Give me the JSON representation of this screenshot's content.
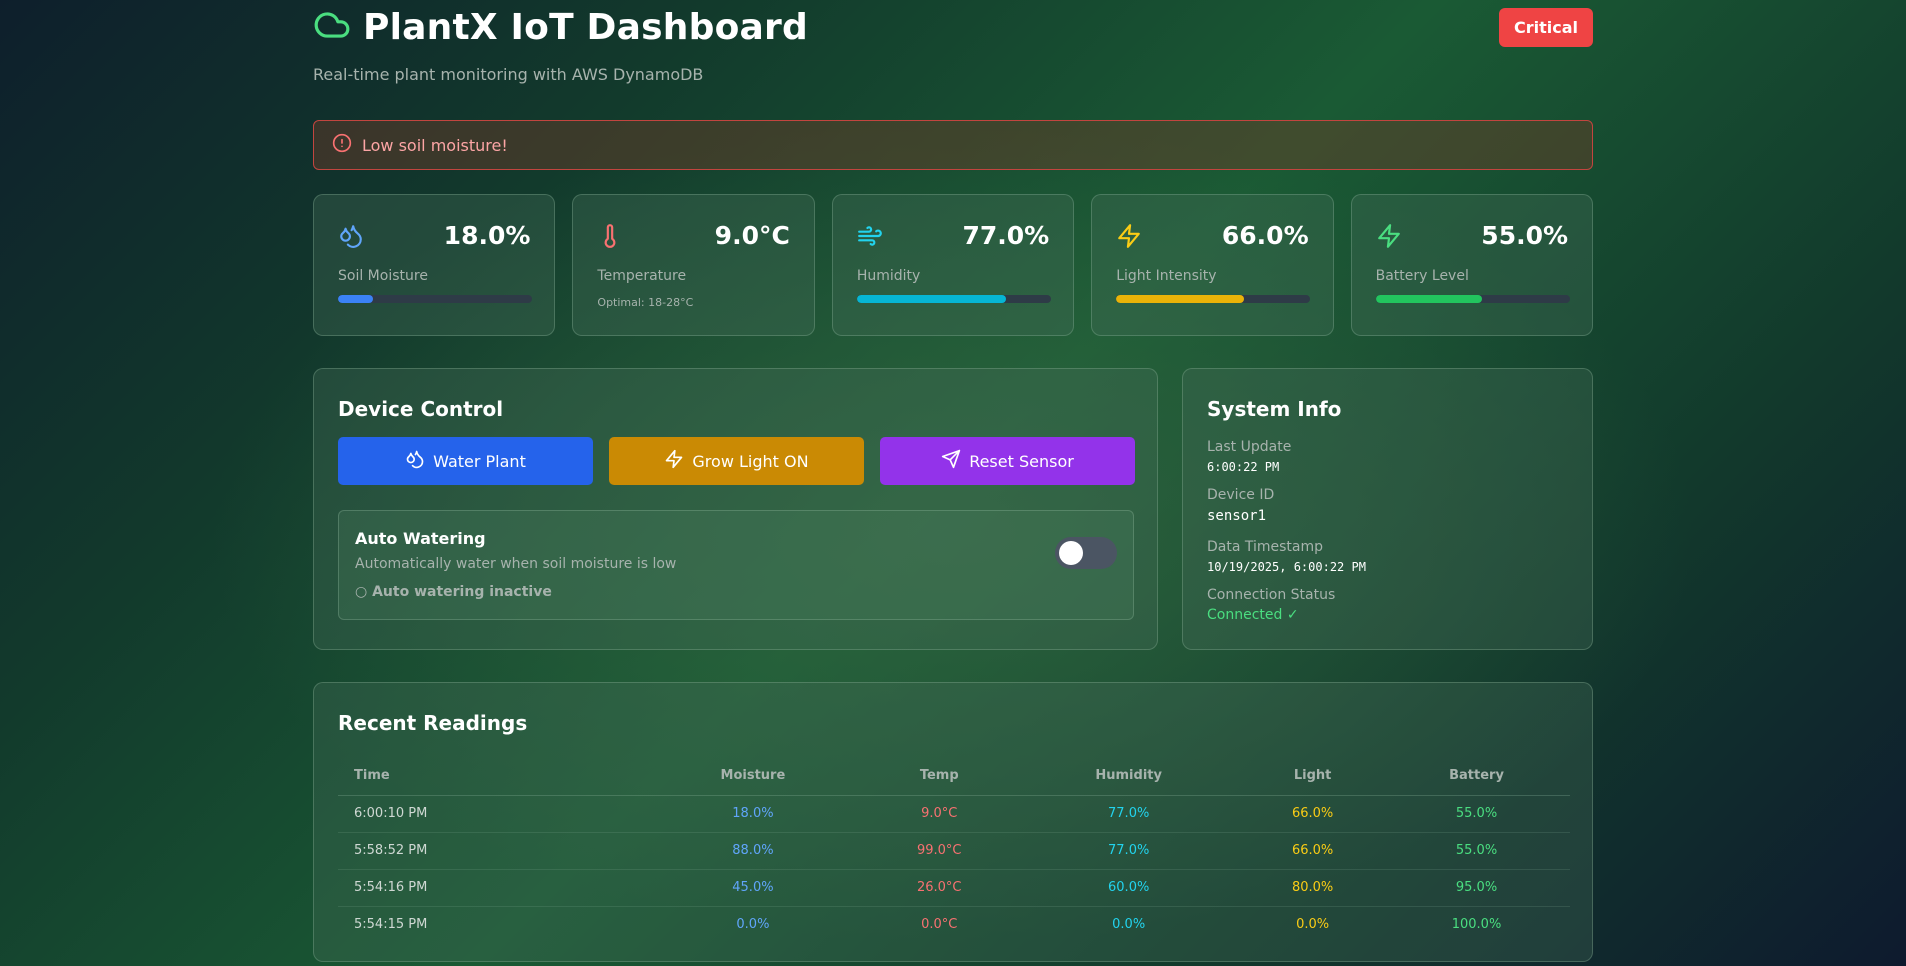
{
  "header": {
    "title": "PlantX IoT Dashboard",
    "subtitle": "Real-time plant monitoring with AWS DynamoDB",
    "status_badge": "Critical",
    "logo_icon": "cloud-icon"
  },
  "alert": {
    "text": "Low soil moisture!",
    "icon": "alert-circle-icon"
  },
  "stats": [
    {
      "label": "Soil Moisture",
      "value": "18.0%",
      "progress": 0.18,
      "color": "#3b82f6",
      "icon": "droplets-icon"
    },
    {
      "label": "Temperature",
      "value": "9.0°C",
      "hint": "Optimal: 18-28°C",
      "color": "#ef4444",
      "icon": "thermometer-icon"
    },
    {
      "label": "Humidity",
      "value": "77.0%",
      "progress": 0.77,
      "color": "#06b6d4",
      "icon": "wind-icon"
    },
    {
      "label": "Light Intensity",
      "value": "66.0%",
      "progress": 0.66,
      "color": "#eab308",
      "icon": "zap-icon"
    },
    {
      "label": "Battery Level",
      "value": "55.0%",
      "progress": 0.55,
      "color": "#22c55e",
      "icon": "zap-icon"
    }
  ],
  "device_control": {
    "title": "Device Control",
    "buttons": [
      {
        "label": "Water Plant",
        "icon": "droplets-icon",
        "color": "#2563eb"
      },
      {
        "label": "Grow Light ON",
        "icon": "zap-icon",
        "color": "#ca8a04"
      },
      {
        "label": "Reset Sensor",
        "icon": "send-icon",
        "color": "#9333ea"
      }
    ],
    "auto_watering": {
      "title": "Auto Watering",
      "description": "Automatically water when soil moisture is low",
      "status": "○ Auto watering inactive",
      "enabled": false
    }
  },
  "system_info": {
    "title": "System Info",
    "last_update_label": "Last Update",
    "last_update": "6:00:22 PM",
    "device_id_label": "Device ID",
    "device_id": "sensor1",
    "timestamp_label": "Data Timestamp",
    "timestamp": "10/19/2025, 6:00:22 PM",
    "connection_label": "Connection Status",
    "connection": "Connected ✓"
  },
  "readings": {
    "title": "Recent Readings",
    "columns": [
      "Time",
      "Moisture",
      "Temp",
      "Humidity",
      "Light",
      "Battery"
    ],
    "rows": [
      [
        "6:00:10 PM",
        "18.0%",
        "9.0°C",
        "77.0%",
        "66.0%",
        "55.0%"
      ],
      [
        "5:58:52 PM",
        "88.0%",
        "99.0°C",
        "77.0%",
        "66.0%",
        "55.0%"
      ],
      [
        "5:54:16 PM",
        "45.0%",
        "26.0°C",
        "60.0%",
        "80.0%",
        "95.0%"
      ],
      [
        "5:54:15 PM",
        "0.0%",
        "0.0°C",
        "0.0%",
        "0.0%",
        "100.0%"
      ]
    ]
  }
}
